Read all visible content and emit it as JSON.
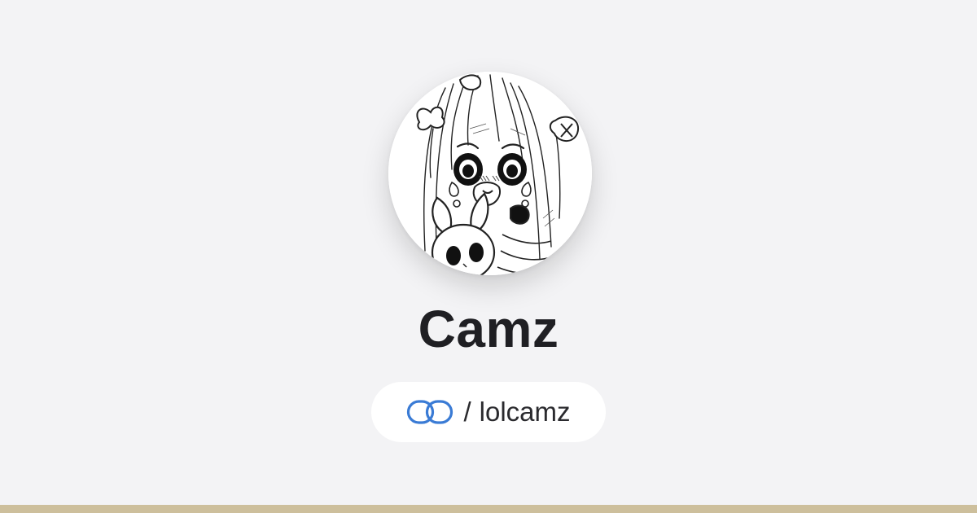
{
  "profile": {
    "name": "Camz",
    "separator": "/",
    "handle": "lolcamz"
  },
  "icons": {
    "link": "linked-rings-icon",
    "avatar": "anime-girl-with-bunny-sketch"
  },
  "colors": {
    "background": "#f3f3f5",
    "accent": "#3a7bd5",
    "footer_bar": "#cdbf9c",
    "text": "#1f1f23"
  }
}
